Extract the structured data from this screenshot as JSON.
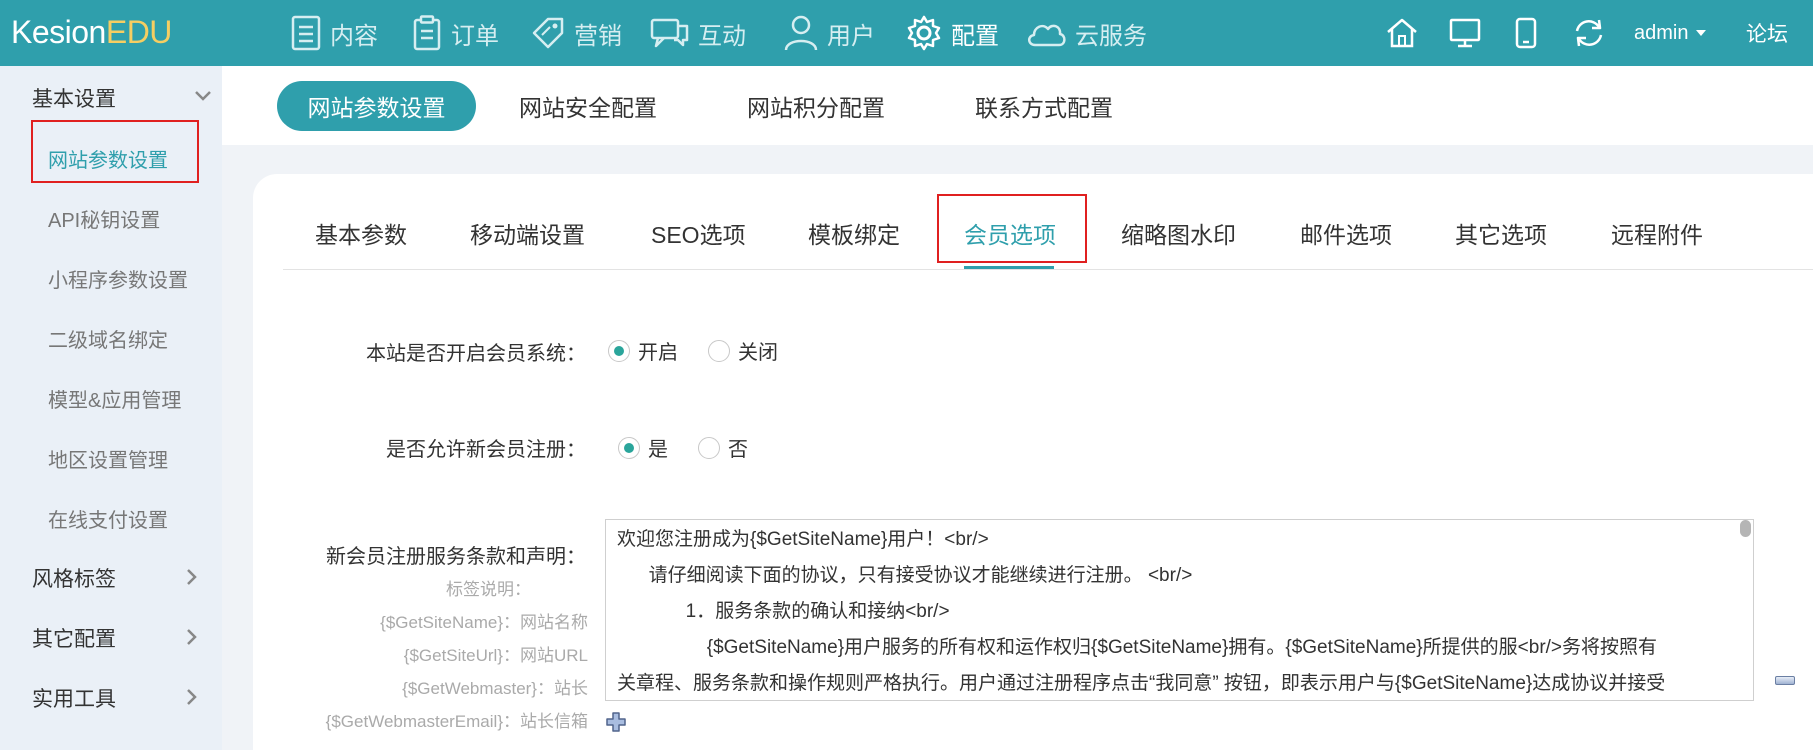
{
  "brand": {
    "logo_main": "Kesion",
    "logo_accent": "EDU"
  },
  "topnav": {
    "items": [
      {
        "label": "内容"
      },
      {
        "label": "订单"
      },
      {
        "label": "营销"
      },
      {
        "label": "互动"
      },
      {
        "label": "用户"
      },
      {
        "label": "配置"
      },
      {
        "label": "云服务"
      }
    ],
    "active_item": "配置",
    "user": "admin",
    "forum": "论坛",
    "icons": [
      "home-icon",
      "desktop-icon",
      "mobile-icon",
      "refresh-icon"
    ]
  },
  "sidebar": {
    "group_basic": "基本设置",
    "items": [
      {
        "label": "网站参数设置"
      },
      {
        "label": "API秘钥设置"
      },
      {
        "label": "小程序参数设置"
      },
      {
        "label": "二级域名绑定"
      },
      {
        "label": "模型&应用管理"
      },
      {
        "label": "地区设置管理"
      },
      {
        "label": "在线支付设置"
      }
    ],
    "groups_collapsed": [
      {
        "label": "风格标签"
      },
      {
        "label": "其它配置"
      },
      {
        "label": "实用工具"
      }
    ]
  },
  "toptabs": [
    {
      "label": "网站参数设置"
    },
    {
      "label": "网站安全配置"
    },
    {
      "label": "网站积分配置"
    },
    {
      "label": "联系方式配置"
    }
  ],
  "subtabs": [
    {
      "label": "基本参数"
    },
    {
      "label": "移动端设置"
    },
    {
      "label": "SEO选项"
    },
    {
      "label": "模板绑定"
    },
    {
      "label": "会员选项"
    },
    {
      "label": "缩略图水印"
    },
    {
      "label": "邮件选项"
    },
    {
      "label": "其它选项"
    },
    {
      "label": "远程附件"
    }
  ],
  "form": {
    "member_system": {
      "label": "本站是否开启会员系统：",
      "options": [
        "开启",
        "关闭"
      ],
      "selected": "开启"
    },
    "allow_register": {
      "label": "是否允许新会员注册：",
      "options": [
        "是",
        "否"
      ],
      "selected": "是"
    },
    "terms": {
      "label": "新会员注册服务条款和声明：",
      "hints": [
        "标签说明：",
        "{$GetSiteName}：网站名称",
        "{$GetSiteUrl}：网站URL",
        "{$GetWebmaster}：站长",
        "{$GetWebmasterEmail}：站长信箱"
      ],
      "lines": [
        "欢迎您注册成为{$GetSiteName}用户！<br/>",
        "      请仔细阅读下面的协议，只有接受协议才能继续进行注册。 <br/>",
        "             1．服务条款的确认和接纳<br/>",
        "                 {$GetSiteName}用户服务的所有权和运作权归{$GetSiteName}拥有。{$GetSiteName}所提供的服<br/>务将按照有",
        "关章程、服务条款和操作规则严格执行。用户通过注册程序点击“我同意” 按钮，即表示用户与{$GetSiteName}达成协议并接受"
      ]
    }
  }
}
